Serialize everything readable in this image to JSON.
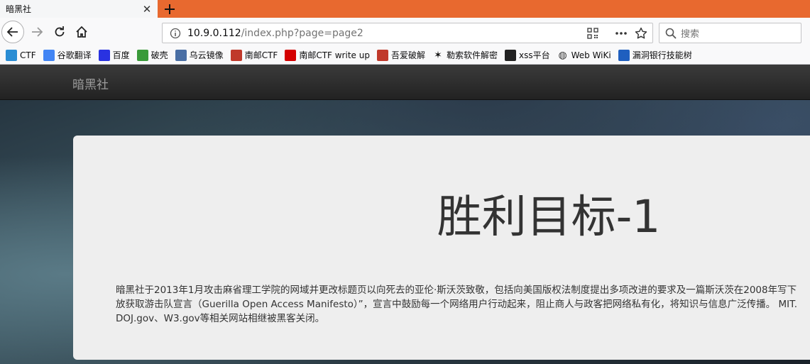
{
  "browser": {
    "tab_title": "暗黑社",
    "url_host": "10.9.0.112",
    "url_path": "/index.php?page=page2",
    "search_placeholder": "搜索"
  },
  "bookmarks": [
    {
      "label": "CTF",
      "icon": "ctf-icon",
      "color": "#2a8dd4"
    },
    {
      "label": "谷歌翻译",
      "icon": "google-translate-icon",
      "color": "#4285f4"
    },
    {
      "label": "百度",
      "icon": "baidu-paw-icon",
      "color": "#2932e1"
    },
    {
      "label": "破壳",
      "icon": "pokeke-icon",
      "color": "#3a9a3a"
    },
    {
      "label": "乌云镜像",
      "icon": "wooyun-icon",
      "color": "#4a6fa5"
    },
    {
      "label": "南邮CTF",
      "icon": "nuptctf-icon",
      "color": "#c0392b"
    },
    {
      "label": "南邮CTF write up",
      "icon": "writeup-icon",
      "color": "#d40000"
    },
    {
      "label": "吾爱破解",
      "icon": "52pojie-icon",
      "color": "#c0392b"
    },
    {
      "label": "勒索软件解密",
      "icon": "star-icon",
      "color": "#111111"
    },
    {
      "label": "xss平台",
      "icon": "xss-icon",
      "color": "#222222"
    },
    {
      "label": "Web WiKi",
      "icon": "globe-icon",
      "color": "#333333"
    },
    {
      "label": "漏洞银行技能树",
      "icon": "bugbank-icon",
      "color": "#1f5fbf"
    }
  ],
  "site": {
    "brand": "暗黑社",
    "heading": "胜利目标-1",
    "paragraph_lines": [
      "暗黑社于2013年1月攻击麻省理工学院的网域并更改标题页以向死去的亚伦·斯沃茨致敬，包括向美国版权法制度提出多项改进的要求及一篇斯沃茨在2008年写下",
      "放获取游击队宣言（Guerilla Open Access Manifesto）”，宣言中鼓励每一个网络用户行动起来，阻止商人与政客把网络私有化，将知识与信息广泛传播。 MIT.",
      "DOJ.gov、W3.gov等相关网站相继被黑客关闭。"
    ]
  },
  "colors": {
    "tab_strip": "#e8692f",
    "navbar": "#222222",
    "jumbotron": "#eeeeee"
  }
}
